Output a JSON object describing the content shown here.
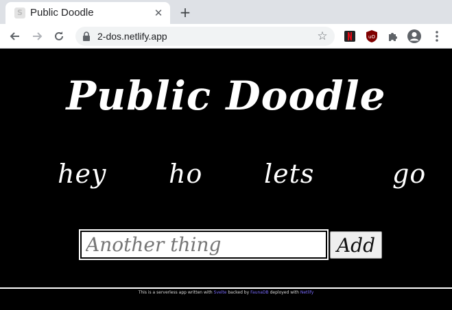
{
  "browser": {
    "tab_title": "Public Doodle",
    "favicon_letter": "S",
    "close_glyph": "✕",
    "new_tab_glyph": "+",
    "url": "2-dos.netlify.app",
    "icons": {
      "back": "arrow-left-icon",
      "forward": "arrow-right-icon",
      "reload": "reload-icon",
      "lock": "lock-icon",
      "star": "star-icon",
      "extension1": "netflix-extension-icon",
      "extension2": "ublock-origin-icon",
      "extensions": "puzzle-piece-icon",
      "profile": "profile-icon",
      "menu": "kebab-menu-icon"
    },
    "colors": {
      "tabstrip": "#dee1e6",
      "toolbar": "#ffffff",
      "omnibox": "#f1f3f4"
    }
  },
  "app": {
    "title": "Public Doodle",
    "items": [
      "hey",
      "ho",
      "lets",
      "go"
    ],
    "input_placeholder": "Another thing",
    "add_button_label": "Add",
    "colors": {
      "background": "#000000",
      "text": "#ffffff",
      "link": "#7b6cff"
    }
  },
  "footer": {
    "prefix": "This is a serverless app written with",
    "framework": "Svelte",
    "middle": "backed by",
    "backend": "FaunaDB",
    "suffix": "deployed with",
    "host": "Netlify"
  }
}
